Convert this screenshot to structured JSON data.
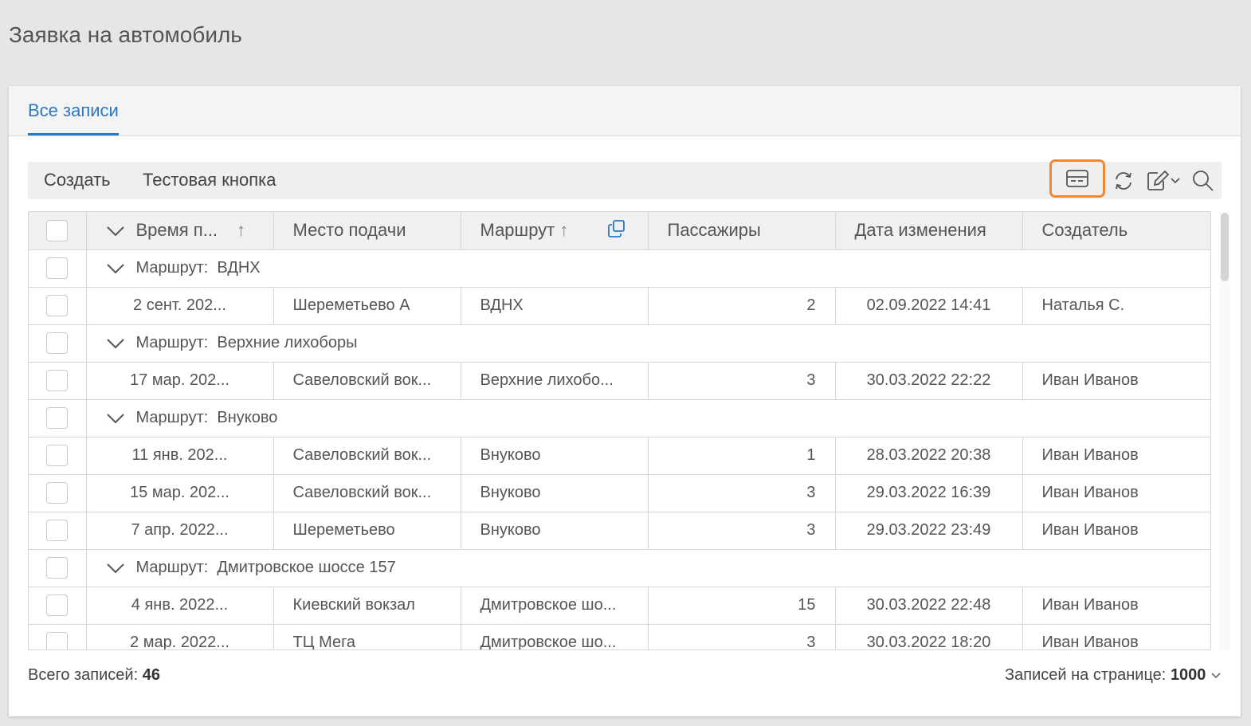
{
  "page": {
    "title": "Заявка на автомобиль"
  },
  "tabs": [
    {
      "label": "Все записи"
    }
  ],
  "toolbar": {
    "create_label": "Создать",
    "test_label": "Тестовая кнопка",
    "icons": [
      "card-view-icon",
      "refresh-icon",
      "edit-icon",
      "search-icon"
    ],
    "highlight_color": "#ef8a33"
  },
  "table": {
    "columns": [
      "Время п...",
      "Место подачи",
      "Маршрут",
      "Пассажиры",
      "Дата изменения",
      "Создатель"
    ],
    "sort_arrow": "↑",
    "group_prefix": "Маршрут:",
    "groups": [
      {
        "name": "ВДНХ",
        "rows": [
          [
            "2 сент. 202...",
            "Шереметьево А",
            "ВДНХ",
            "2",
            "02.09.2022 14:41",
            "Наталья С."
          ]
        ]
      },
      {
        "name": "Верхние лихоборы",
        "rows": [
          [
            "17 мар. 202...",
            "Савеловский вок...",
            "Верхние лихобо...",
            "3",
            "30.03.2022 22:22",
            "Иван Иванов"
          ]
        ]
      },
      {
        "name": "Внуково",
        "rows": [
          [
            "11 янв. 202...",
            "Савеловский вок...",
            "Внуково",
            "1",
            "28.03.2022 20:38",
            "Иван Иванов"
          ],
          [
            "15 мар. 202...",
            "Савеловский вок...",
            "Внуково",
            "3",
            "29.03.2022 16:39",
            "Иван Иванов"
          ],
          [
            "7 апр. 2022...",
            "Шереметьево",
            "Внуково",
            "3",
            "29.03.2022 23:49",
            "Иван Иванов"
          ]
        ]
      },
      {
        "name": "Дмитровское шоссе 157",
        "rows": [
          [
            "4 янв. 2022...",
            "Киевский вокзал",
            "Дмитровское шо...",
            "15",
            "30.03.2022 22:48",
            "Иван Иванов"
          ],
          [
            "2 мар. 2022...",
            "ТЦ Мега",
            "Дмитровское шо...",
            "3",
            "30.03.2022 18:20",
            "Иван Иванов"
          ]
        ]
      }
    ]
  },
  "footer": {
    "total_label": "Всего записей:",
    "total_value": "46",
    "per_page_label": "Записей на странице:",
    "per_page_value": "1000"
  }
}
